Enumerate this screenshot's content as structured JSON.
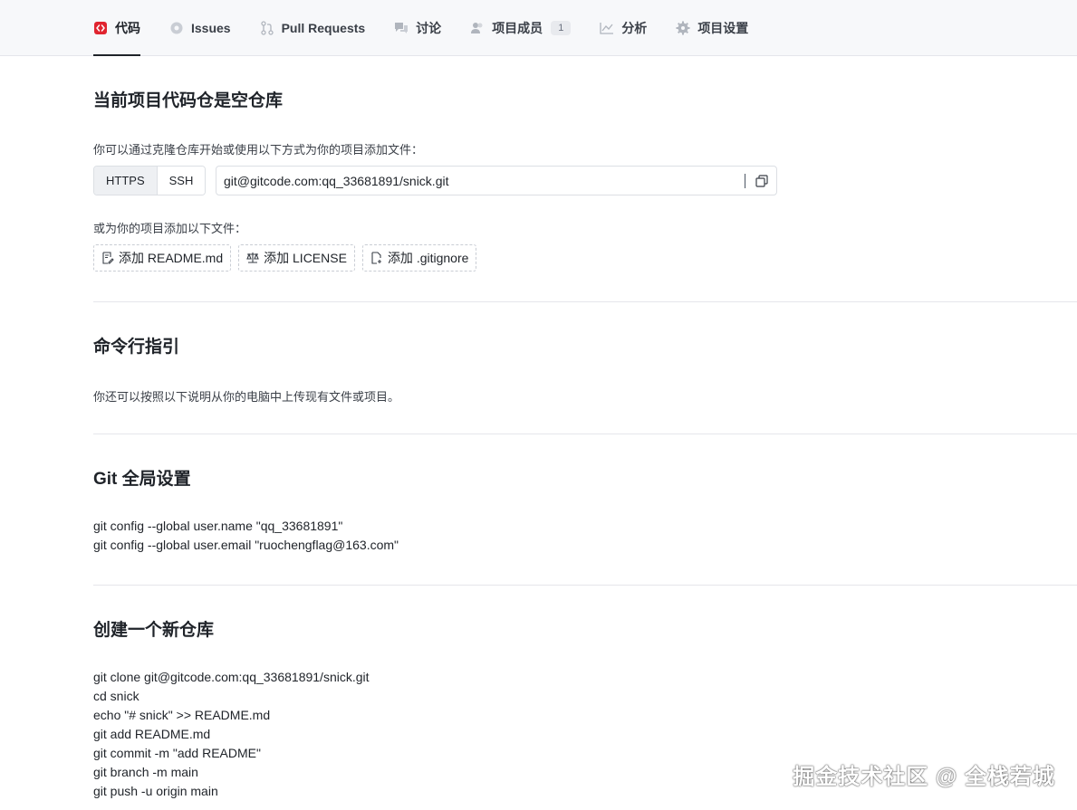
{
  "tabs": [
    {
      "label": "代码",
      "icon": "code-icon",
      "active": true
    },
    {
      "label": "Issues",
      "icon": "issues-icon"
    },
    {
      "label": "Pull Requests",
      "icon": "pull-request-icon"
    },
    {
      "label": "讨论",
      "icon": "discussion-icon"
    },
    {
      "label": "项目成员",
      "icon": "members-icon",
      "badge": "1"
    },
    {
      "label": "分析",
      "icon": "analytics-icon"
    },
    {
      "label": "项目设置",
      "icon": "settings-gear-icon"
    }
  ],
  "empty_repo": {
    "title": "当前项目代码仓是空仓库",
    "hint": "你可以通过克隆仓库开始或使用以下方式为你的项目添加文件：",
    "protocols": [
      "HTTPS",
      "SSH"
    ],
    "clone_url": "git@gitcode.com:qq_33681891/snick.git",
    "add_files_hint": "或为你的项目添加以下文件：",
    "add_buttons": [
      "添加 README.md",
      "添加 LICENSE",
      "添加 .gitignore"
    ]
  },
  "cli": {
    "title": "命令行指引",
    "desc": "你还可以按照以下说明从你的电脑中上传现有文件或项目。"
  },
  "git_config": {
    "title": "Git 全局设置",
    "lines": [
      "git config --global user.name \"qq_33681891\"",
      "git config --global user.email \"ruochengflag@163.com\""
    ]
  },
  "new_repo": {
    "title": "创建一个新仓库",
    "lines": [
      "git clone git@gitcode.com:qq_33681891/snick.git",
      "cd snick",
      "echo \"# snick\" >> README.md",
      "git add README.md",
      "git commit -m \"add README\"",
      "git branch -m main",
      "git push -u origin main"
    ]
  },
  "watermark": "掘金技术社区 @ 全栈若城",
  "colors": {
    "accent_red": "#e0242f",
    "text": "#1f2329",
    "border": "#dcdfe4"
  }
}
